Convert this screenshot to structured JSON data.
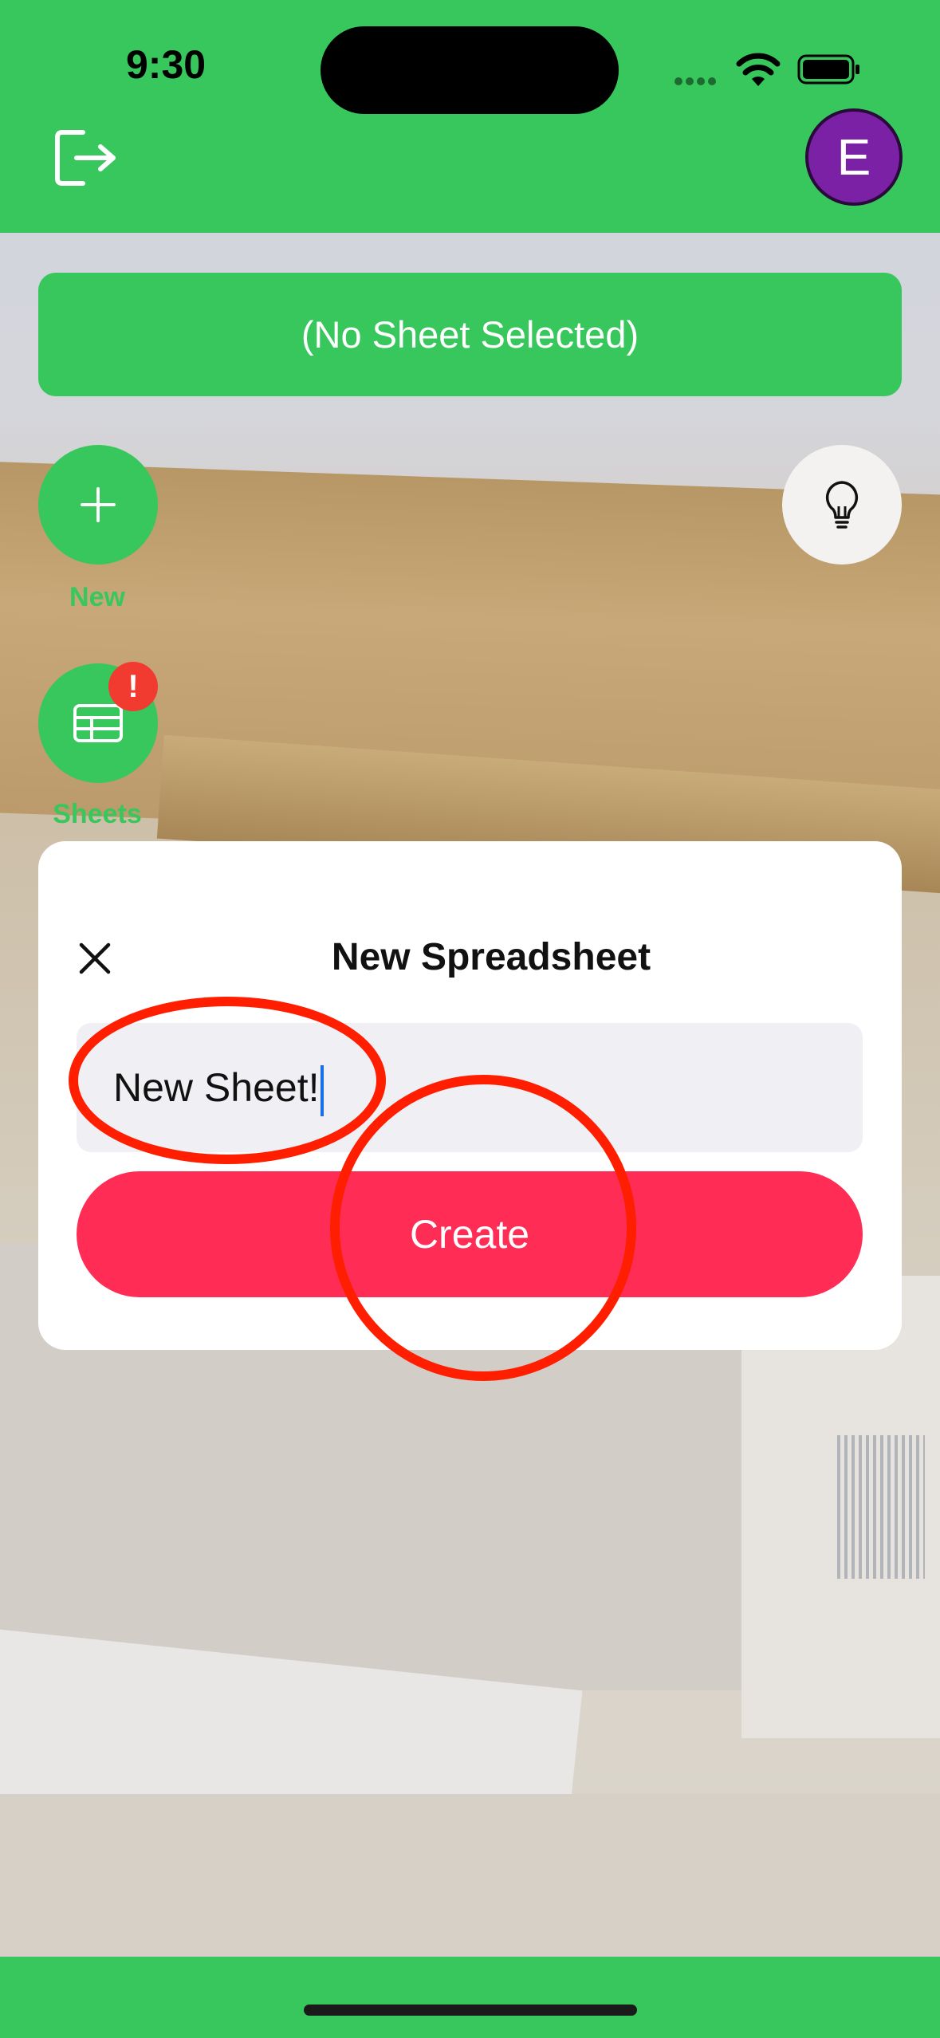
{
  "status_bar": {
    "time": "9:30"
  },
  "header": {
    "avatar_initial": "E"
  },
  "sheet_selector": {
    "label": "(No Sheet Selected)"
  },
  "actions": {
    "new_label": "New",
    "sheets_label": "Sheets",
    "sheets_badge": "!"
  },
  "modal": {
    "title": "New Spreadsheet",
    "input_value": "New Sheet!",
    "create_label": "Create"
  },
  "colors": {
    "primary_green": "#37c75c",
    "create_pink": "#ff2d55",
    "avatar_purple": "#7b21a6",
    "annotation_red": "#ff1e00"
  },
  "icons": [
    "logout-icon",
    "plus-icon",
    "table-icon",
    "lightbulb-icon",
    "close-icon",
    "wifi-icon",
    "battery-icon"
  ]
}
